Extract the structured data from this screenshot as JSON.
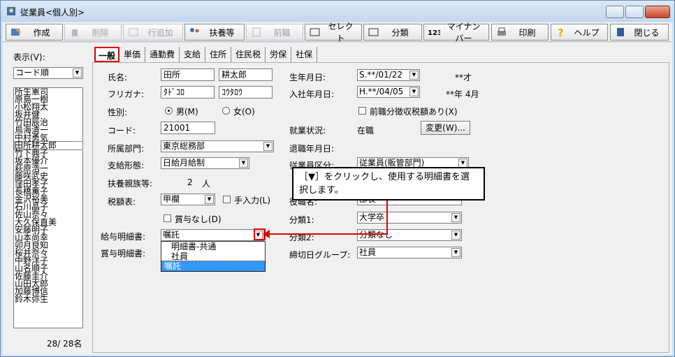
{
  "window": {
    "title": "従業員<個人別>"
  },
  "toolbar": {
    "create": "作成",
    "delete": "削除",
    "add_row": "行追加",
    "dependents": "扶養等",
    "prev_job": "前職",
    "select": "セレクト",
    "classify": "分類",
    "mynumber": "マイナンバー",
    "print": "印刷",
    "help": "ヘルプ",
    "close": "閉じる"
  },
  "left": {
    "display_label": "表示(V):",
    "sort_value": "コード順",
    "names": [
      "所生憲司",
      "原島一樹",
      "小松翔太",
      "坂井健",
      "竹田辰治",
      "鳥海清一",
      "中村勇気",
      "田所耕太郎",
      "竹下典子",
      "坂本優介",
      "萩原浩一",
      "藤咲武史",
      "窪田孝子",
      "長橋薫子",
      "金沢裕美",
      "石川晶子",
      "佐山奈々",
      "大久保直美",
      "安藤明子",
      "山本尚幸",
      "卯月良知",
      "桜井奈々",
      "中野洋子",
      "山名順子",
      "佐藤圭介",
      "山田太郎",
      "加藤博信",
      "鈴木弥生"
    ],
    "count": "28/ 28名"
  },
  "tabs": [
    "一般",
    "単価",
    "通勤費",
    "支給",
    "住所",
    "住民税",
    "労保",
    "社保"
  ],
  "form": {
    "name_label": "氏名:",
    "last_name": "田所",
    "first_name": "耕太郎",
    "kana_label": "フリガナ:",
    "last_kana": "ﾀﾄﾞｺﾛ",
    "first_kana": "ｺｳﾀﾛｳ",
    "gender_label": "性別:",
    "male": "男(M)",
    "female": "女(O)",
    "code_label": "コード:",
    "code": "21001",
    "dept_label": "所属部門:",
    "dept": "東京総務部",
    "pay_label": "支給形態:",
    "pay": "日給月給制",
    "dependents_label": "扶養親族等:",
    "dependents_value": "2",
    "dependents_unit": "人",
    "tax_label": "税額表:",
    "tax": "甲欄",
    "manual": "手入力(L)",
    "no_bonus": "賞与なし(D)",
    "payslip_label": "給与明細書:",
    "payslip": "嘱託",
    "bonusslip_label": "賞与明細書:",
    "birth_label": "生年月日:",
    "birth": "S.**/01/22",
    "age": "**才",
    "hire_label": "入社年月日:",
    "hire": "H.**/04/05",
    "tenure": "**年 4月",
    "prev_tax": "前職分徴収税額あり(X)",
    "status_label": "就業状況:",
    "status": "在職",
    "change_btn": "変更(W)...",
    "retire_label": "退職年月日:",
    "emp_class_label": "従業員区分:",
    "emp_class": "従業員(販管部門)",
    "post_label": "役職名:",
    "post": "部長",
    "class1_label": "分類1:",
    "class1": "大学卒",
    "class2_label": "分類2:",
    "class2": "分類なし",
    "cutoff_label": "締切日グループ:",
    "cutoff": "社員"
  },
  "dropdown": [
    "明細書-共通",
    "社員",
    "嘱託"
  ],
  "callout": "［▼］をクリックし、使用する明細書を選択します。"
}
